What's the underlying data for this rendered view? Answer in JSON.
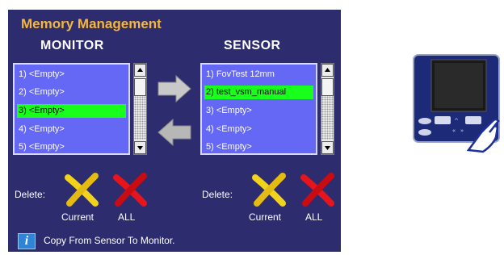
{
  "panel": {
    "title": "Memory Management",
    "monitor": {
      "heading": "MONITOR",
      "items": [
        "1) <Empty>",
        "2) <Empty>",
        "3) <Empty>",
        "4) <Empty>",
        "5) <Empty>"
      ],
      "selected_index": 2
    },
    "sensor": {
      "heading": "SENSOR",
      "items": [
        "1) FovTest 12mm",
        "2) test_vsm_manual",
        "3) <Empty>",
        "4) <Empty>",
        "5) <Empty>"
      ],
      "selected_index": 1
    },
    "delete_label": "Delete:",
    "current_label": "Current",
    "all_label": "ALL",
    "status_text": "Copy From Sensor To Monitor.",
    "info_icon_glyph": "i"
  },
  "colors": {
    "panel_bg": "#2d2c6e",
    "title": "#f5b73b",
    "list_bg": "#6468f5",
    "selection": "#19ff1c",
    "current_x": "#f2d21a",
    "all_x": "#e8141c"
  },
  "icons": [
    "arrow-right-icon",
    "arrow-left-icon",
    "delete-current-icon",
    "delete-all-icon",
    "info-icon",
    "device-icon",
    "hand-pointer-icon"
  ]
}
